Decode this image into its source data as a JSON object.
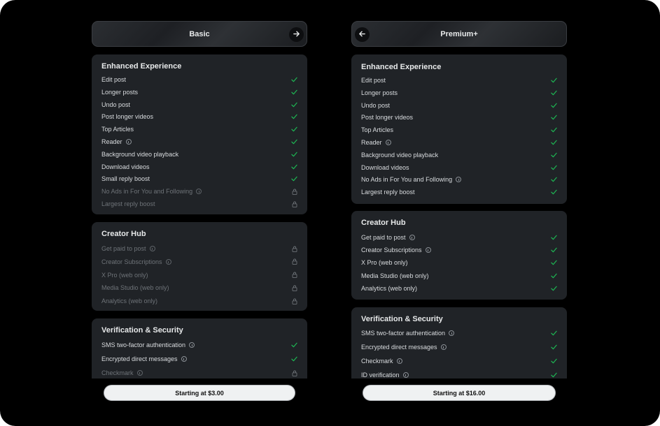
{
  "colors": {
    "check": "#1db954",
    "lock": "#6e7378",
    "card_bg": "#202327",
    "page_bg": "#000000"
  },
  "basic": {
    "title": "Basic",
    "next_icon": "arrow-right-icon",
    "enhanced": {
      "title": "Enhanced Experience",
      "rows": [
        {
          "label": "Edit post",
          "info": false,
          "status": "check"
        },
        {
          "label": "Longer posts",
          "info": false,
          "status": "check"
        },
        {
          "label": "Undo post",
          "info": false,
          "status": "check"
        },
        {
          "label": "Post longer videos",
          "info": false,
          "status": "check"
        },
        {
          "label": "Top Articles",
          "info": false,
          "status": "check"
        },
        {
          "label": "Reader",
          "info": true,
          "status": "check"
        },
        {
          "label": "Background video playback",
          "info": false,
          "status": "check"
        },
        {
          "label": "Download videos",
          "info": false,
          "status": "check"
        },
        {
          "label": "Small reply boost",
          "info": false,
          "status": "check"
        },
        {
          "label": "No Ads in For You and Following",
          "info": true,
          "status": "lock"
        },
        {
          "label": "Largest reply boost",
          "info": false,
          "status": "lock"
        }
      ]
    },
    "creator": {
      "title": "Creator Hub",
      "rows": [
        {
          "label": "Get paid to post",
          "info": true,
          "status": "lock"
        },
        {
          "label": "Creator Subscriptions",
          "info": true,
          "status": "lock"
        },
        {
          "label": "X Pro (web only)",
          "info": false,
          "status": "lock"
        },
        {
          "label": "Media Studio (web only)",
          "info": false,
          "status": "lock"
        },
        {
          "label": "Analytics (web only)",
          "info": false,
          "status": "lock"
        }
      ]
    },
    "verification": {
      "title": "Verification & Security",
      "rows": [
        {
          "label": "SMS two-factor authentication",
          "info": true,
          "status": "check"
        },
        {
          "label": "Encrypted direct messages",
          "info": true,
          "status": "check"
        },
        {
          "label": "Checkmark",
          "info": true,
          "status": "lock"
        }
      ]
    },
    "cta": "Starting at $3.00"
  },
  "premium": {
    "title": "Premium+",
    "back_icon": "arrow-left-icon",
    "enhanced": {
      "title": "Enhanced Experience",
      "rows": [
        {
          "label": "Edit post",
          "info": false,
          "status": "check"
        },
        {
          "label": "Longer posts",
          "info": false,
          "status": "check"
        },
        {
          "label": "Undo post",
          "info": false,
          "status": "check"
        },
        {
          "label": "Post longer videos",
          "info": false,
          "status": "check"
        },
        {
          "label": "Top Articles",
          "info": false,
          "status": "check"
        },
        {
          "label": "Reader",
          "info": true,
          "status": "check"
        },
        {
          "label": "Background video playback",
          "info": false,
          "status": "check"
        },
        {
          "label": "Download videos",
          "info": false,
          "status": "check"
        },
        {
          "label": "No Ads in For You and Following",
          "info": true,
          "status": "check"
        },
        {
          "label": "Largest reply boost",
          "info": false,
          "status": "check"
        }
      ]
    },
    "creator": {
      "title": "Creator Hub",
      "rows": [
        {
          "label": "Get paid to post",
          "info": true,
          "status": "check"
        },
        {
          "label": "Creator Subscriptions",
          "info": true,
          "status": "check"
        },
        {
          "label": "X Pro (web only)",
          "info": false,
          "status": "check"
        },
        {
          "label": "Media Studio (web only)",
          "info": false,
          "status": "check"
        },
        {
          "label": "Analytics (web only)",
          "info": false,
          "status": "check"
        }
      ]
    },
    "verification": {
      "title": "Verification & Security",
      "rows": [
        {
          "label": "SMS two-factor authentication",
          "info": true,
          "status": "check"
        },
        {
          "label": "Encrypted direct messages",
          "info": true,
          "status": "check"
        },
        {
          "label": "Checkmark",
          "info": true,
          "status": "check"
        },
        {
          "label": "ID verification",
          "info": true,
          "status": "check"
        }
      ]
    },
    "cta": "Starting at $16.00"
  }
}
